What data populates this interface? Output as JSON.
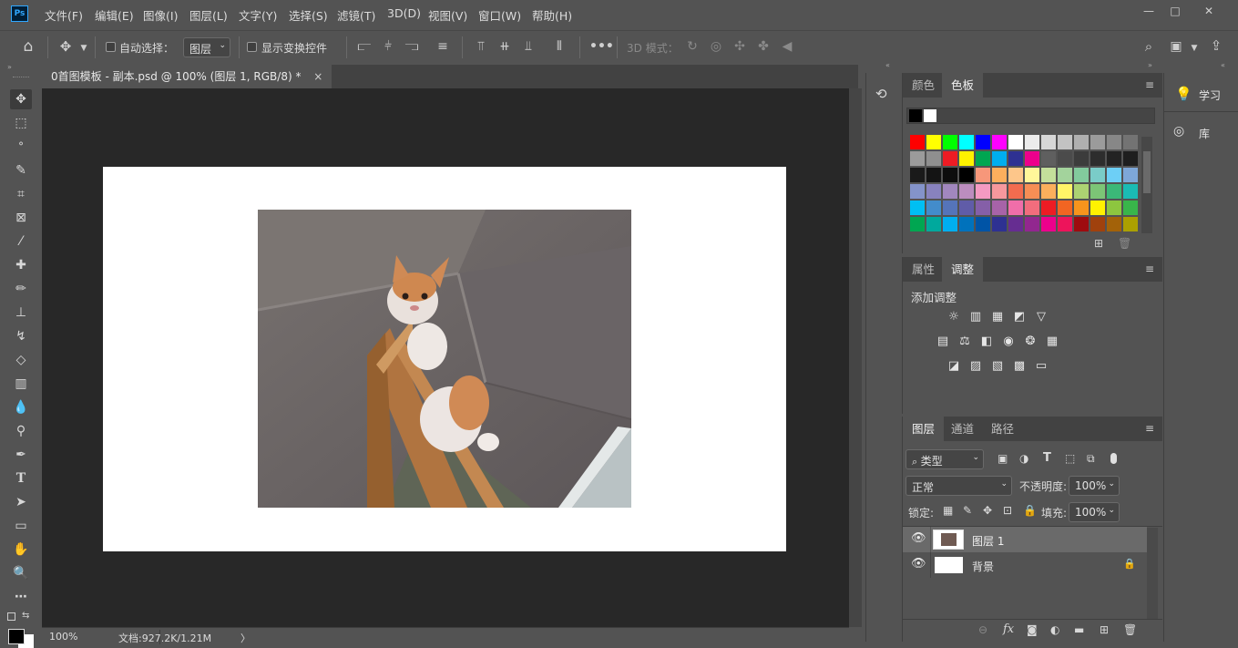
{
  "menubar": {
    "logo": "Ps",
    "items": [
      "文件(F)",
      "编辑(E)",
      "图像(I)",
      "图层(L)",
      "文字(Y)",
      "选择(S)",
      "滤镜(T)",
      "3D(D)",
      "视图(V)",
      "窗口(W)",
      "帮助(H)"
    ],
    "window_controls": {
      "minimize": "—",
      "maximize": "□",
      "close": "✕"
    }
  },
  "options": {
    "auto_select_label": "自动选择：",
    "auto_select_value": "图层",
    "show_transform_label": "显示变换控件",
    "mode3d_label": "3D 模式："
  },
  "document": {
    "tab_title": "0首图模板 - 副本.psd @ 100% (图层 1, RGB/8) *",
    "tab_close": "×",
    "photo_desc_icon": "cat-photo"
  },
  "status": {
    "zoom": "100%",
    "doc_info": "文档:927.2K/1.21M",
    "arrow": "〉"
  },
  "swatch_panel": {
    "tabs": [
      "颜色",
      "色板"
    ],
    "active_tab": "色板",
    "colors": [
      [
        "#ff0000",
        "#ffff00",
        "#00ff00",
        "#00ffff",
        "#0000ff",
        "#ff00ff",
        "#ffffff",
        "#ebebeb",
        "#d7d7d7",
        "#c3c3c3",
        "#afafaf",
        "#9b9b9b",
        "#878787",
        "#737373"
      ],
      [
        "#9b9b9b",
        "#8f8f8f",
        "#ed1c24",
        "#fff200",
        "#00a651",
        "#00aeef",
        "#2e3192",
        "#ec008c",
        "#5f5f5f",
        "#4b4b4b",
        "#3c3c3c",
        "#2d2d2d",
        "#232323",
        "#1e1e1e"
      ],
      [
        "#1a1a1a",
        "#141414",
        "#0d0d0d",
        "#000000",
        "#f7977a",
        "#fbaf5d",
        "#fdc68a",
        "#fff79a",
        "#c4df9b",
        "#a3d39c",
        "#82ca9d",
        "#7accc8",
        "#6dcff6",
        "#7ea7d8"
      ],
      [
        "#8493ca",
        "#8882be",
        "#a187be",
        "#bc8dbf",
        "#f49ac2",
        "#f6989d",
        "#f26c4f",
        "#f68e55",
        "#fbaf5c",
        "#fff467",
        "#acd372",
        "#7cc576",
        "#3bb878",
        "#1abbb4"
      ],
      [
        "#00bff3",
        "#438ccb",
        "#5574b9",
        "#605ca8",
        "#855fa8",
        "#a763a8",
        "#f06ea9",
        "#f26d7d",
        "#ed1c24",
        "#f26522",
        "#f7941d",
        "#fff200",
        "#8dc63f",
        "#39b54a"
      ],
      [
        "#00a651",
        "#00a99d",
        "#00aeef",
        "#0072bc",
        "#0054a6",
        "#2e3192",
        "#662d91",
        "#92278f",
        "#ec008c",
        "#ed145b",
        "#9e0b0f",
        "#a0410d",
        "#a36209",
        "#aba000"
      ]
    ]
  },
  "adjust_panel": {
    "tabs": [
      "属性",
      "调整"
    ],
    "active_tab": "调整",
    "title": "添加调整",
    "row1": [
      "☼",
      "▥",
      "▦",
      "◩",
      "▽"
    ],
    "row2": [
      "▤",
      "⚖",
      "◧",
      "◉",
      "❂",
      "▦"
    ],
    "row3": [
      "◪",
      "▨",
      "▧",
      "▩",
      "▭"
    ]
  },
  "layers_panel": {
    "tabs": [
      "图层",
      "通道",
      "路径"
    ],
    "active_tab": "图层",
    "filter_label": "类型",
    "blend_mode": "正常",
    "opacity_label": "不透明度:",
    "opacity_value": "100%",
    "lock_label": "锁定:",
    "fill_label": "填充:",
    "fill_value": "100%",
    "layers": [
      {
        "name": "图层 1",
        "visible": true,
        "locked": false
      },
      {
        "name": "背景",
        "visible": true,
        "locked": true
      }
    ]
  },
  "learn_panel": {
    "items": [
      "学习",
      "库"
    ]
  }
}
